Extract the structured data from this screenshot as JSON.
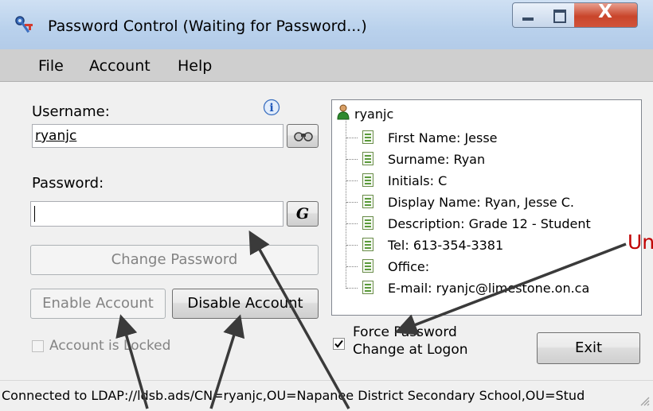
{
  "window": {
    "title": "Password Control  (Waiting for Password...)",
    "close_glyph": "X"
  },
  "menu": {
    "items": [
      "File",
      "Account",
      "Help"
    ]
  },
  "form": {
    "username_label": "Username:",
    "username_value": "ryanjc",
    "password_label": "Password:",
    "password_value": "",
    "generate_label": "G",
    "change_password_label": "Change Password",
    "enable_account_label": "Enable Account",
    "disable_account_label": "Disable Account",
    "locked_label": "Account is Locked",
    "force_label_line1": "Force Password",
    "force_label_line2": "Change at Logon",
    "force_checked": true,
    "exit_label": "Exit"
  },
  "tree": {
    "root": "ryanjc",
    "items": [
      "First Name: Jesse",
      "Surname: Ryan",
      "Initials: C",
      "Display Name: Ryan, Jesse C.",
      "Description: Grade 12 - Student",
      "Tel: 613-354-3381",
      "Office:",
      "E-mail: ryanjc@limestone.on.ca"
    ]
  },
  "status": {
    "text": "Connected to LDAP://ldsb.ads/CN=ryanjc,OU=Napanee District Secondary School,OU=Stud"
  },
  "annotation": {
    "text": "Unc"
  },
  "colors": {
    "annotation": "#c00000",
    "arrow": "#3a3a3a"
  },
  "icons": [
    "key-app-icon",
    "info-icon",
    "binoculars-icon",
    "user-icon",
    "document-icon"
  ]
}
